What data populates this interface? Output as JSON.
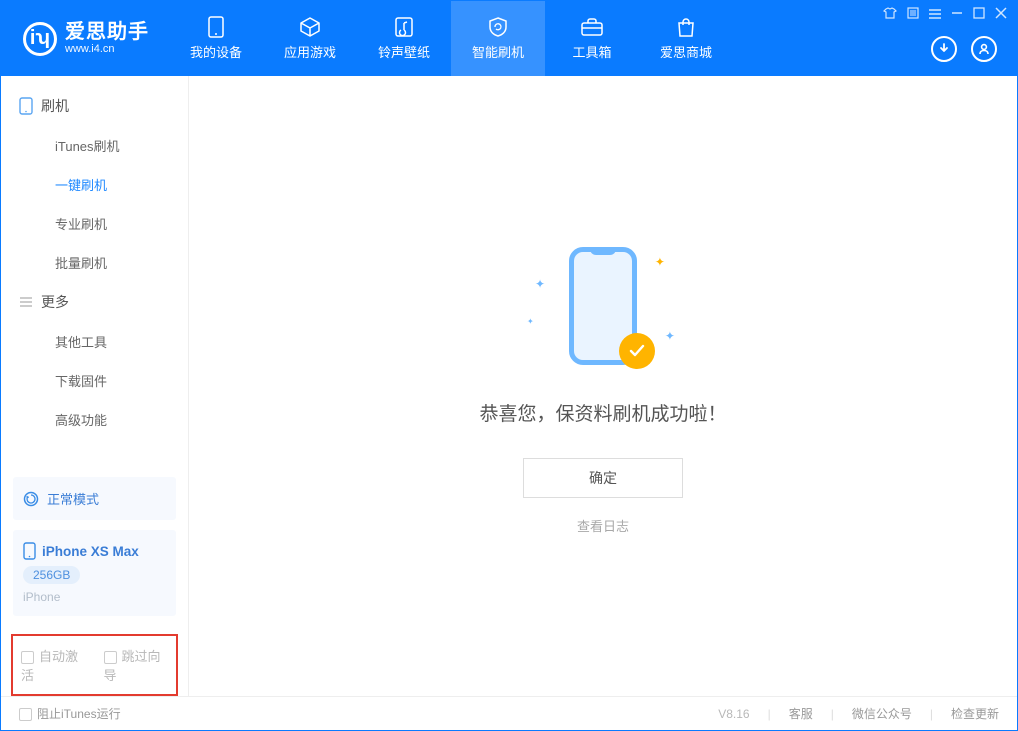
{
  "header": {
    "app_name": "爱思助手",
    "app_url": "www.i4.cn",
    "tabs": [
      "我的设备",
      "应用游戏",
      "铃声壁纸",
      "智能刷机",
      "工具箱",
      "爱思商城"
    ]
  },
  "sidebar": {
    "sections": [
      {
        "title": "刷机",
        "items": [
          "iTunes刷机",
          "一键刷机",
          "专业刷机",
          "批量刷机"
        ]
      },
      {
        "title": "更多",
        "items": [
          "其他工具",
          "下载固件",
          "高级功能"
        ]
      }
    ],
    "mode_label": "正常模式",
    "device": {
      "name": "iPhone XS Max",
      "storage": "256GB",
      "type": "iPhone"
    },
    "checkboxes": [
      "自动激活",
      "跳过向导"
    ]
  },
  "main": {
    "success_message": "恭喜您，保资料刷机成功啦！",
    "confirm_label": "确定",
    "log_link": "查看日志"
  },
  "footer": {
    "block_itunes": "阻止iTunes运行",
    "version": "V8.16",
    "links": [
      "客服",
      "微信公众号",
      "检查更新"
    ]
  }
}
